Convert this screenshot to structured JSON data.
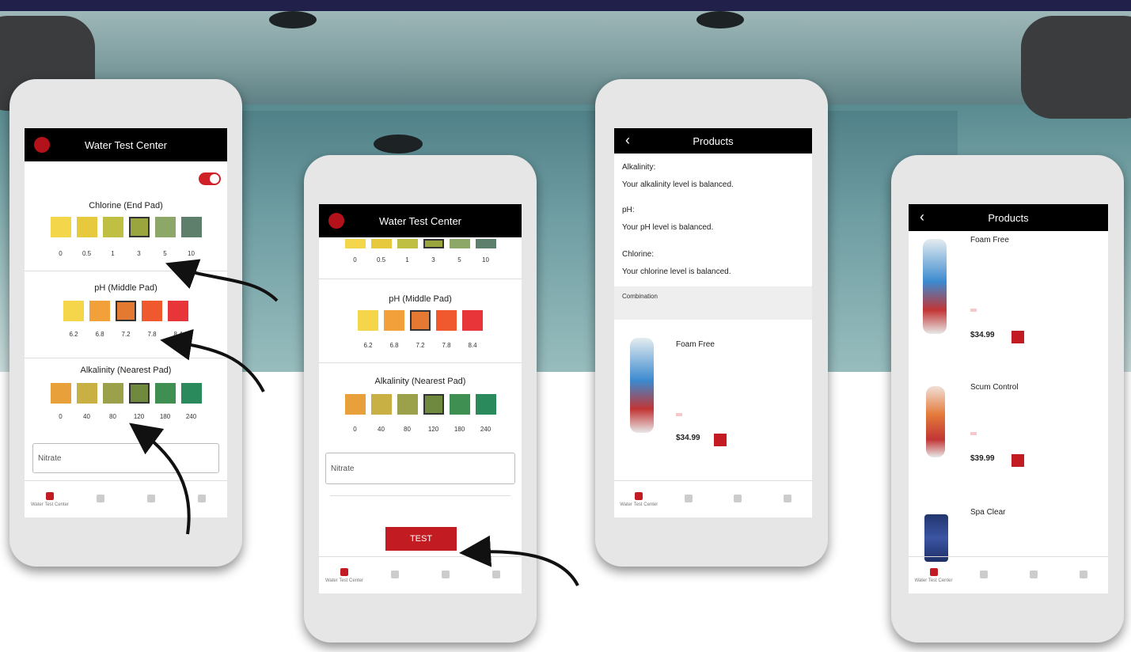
{
  "colors": {
    "brand_red": "#c21b22",
    "header_black": "#000000",
    "positive_green": "#4fbf6f"
  },
  "screen1": {
    "title": "Water Test Center",
    "toggle_label": "",
    "chlorine": {
      "label": "Chlorine (End Pad)",
      "colors": [
        "#f3d64a",
        "#e7c93e",
        "#bfc043",
        "#9aa53e",
        "#8da768",
        "#5f7f6d"
      ],
      "values": [
        "0",
        "0.5",
        "1",
        "3",
        "5",
        "10"
      ],
      "selected": 3
    },
    "ph": {
      "label": "pH (Middle Pad)",
      "colors": [
        "#f5d54a",
        "#f2a13a",
        "#e47931",
        "#f0582e",
        "#e8353a"
      ],
      "values": [
        "6.2",
        "6.8",
        "7.2",
        "7.8",
        "8.4"
      ],
      "selected": 2
    },
    "alkalinity": {
      "label": "Alkalinity (Nearest Pad)",
      "colors": [
        "#e8a03a",
        "#c9b044",
        "#9aa14a",
        "#6f8a3e",
        "#3f8e52",
        "#2a8a5c"
      ],
      "values": [
        "0",
        "40",
        "80",
        "120",
        "180",
        "240"
      ],
      "selected": 3
    },
    "select_value": "Nitrate",
    "tabs": [
      "Water Test Center",
      "",
      "",
      ""
    ]
  },
  "screen2": {
    "title": "Water Test Center",
    "top_values": [
      "0",
      "0.5",
      "1",
      "3",
      "5",
      "10"
    ],
    "ph": {
      "label": "pH (Middle Pad)",
      "colors": [
        "#f5d54a",
        "#f2a13a",
        "#e47931",
        "#f0582e",
        "#e8353a"
      ],
      "values": [
        "6.2",
        "6.8",
        "7.2",
        "7.8",
        "8.4"
      ],
      "selected": 2
    },
    "alkalinity": {
      "label": "Alkalinity (Nearest Pad)",
      "colors": [
        "#e8a03a",
        "#c9b044",
        "#9aa14a",
        "#6f8a3e",
        "#3f8e52",
        "#2a8a5c"
      ],
      "values": [
        "0",
        "40",
        "80",
        "120",
        "180",
        "240"
      ],
      "selected": 3
    },
    "select_value": "Nitrate",
    "test_button": "TEST",
    "tabs": [
      "Water Test Center",
      "",
      "",
      ""
    ]
  },
  "screen3": {
    "title": "Products",
    "alkalinity_label": "Alkalinity:",
    "alkalinity_status": "",
    "alkalinity_msg": "Your alkalinity level is balanced.",
    "ph_label": "pH:",
    "ph_status": "",
    "ph_msg": "Your pH level is balanced.",
    "chlorine_label": "Chlorine:",
    "chlorine_status": "",
    "chlorine_msg": "Your chlorine level is balanced.",
    "combination_title": "Combination",
    "combination_text": "",
    "product": {
      "name": "Foam Free",
      "description": "",
      "shipping_badge": "",
      "price": "$34.99"
    },
    "tabs": [
      "Water Test Center",
      "",
      "",
      ""
    ]
  },
  "screen4": {
    "title": "Products",
    "products": [
      {
        "name": "Foam Free",
        "description": "",
        "shipping_badge": "",
        "price": "$34.99"
      },
      {
        "name": "Scum Control",
        "description": "",
        "shipping_badge": "",
        "price": "$39.99"
      },
      {
        "name": "Spa Clear",
        "description": "",
        "price": ""
      }
    ],
    "tabs": [
      "Water Test Center",
      "",
      "",
      ""
    ]
  }
}
